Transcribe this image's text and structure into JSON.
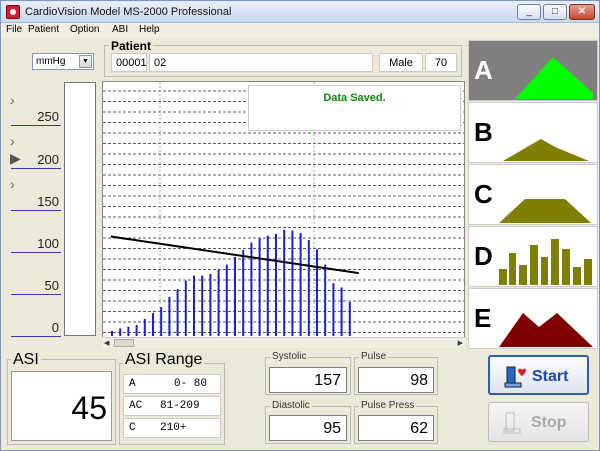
{
  "window": {
    "title": "CardioVision Model MS-2000 Professional"
  },
  "menu": [
    "File",
    "Patient",
    "Option",
    "ABI",
    "Help"
  ],
  "unit_select": {
    "value": "mmHg"
  },
  "patient": {
    "legend": "Patient",
    "id": "00001",
    "name": "02",
    "sex": "Male",
    "age": "70"
  },
  "scale": {
    "ticks": [
      "250",
      "200",
      "150",
      "100",
      "50",
      "0"
    ]
  },
  "status": {
    "message": "Data Saved."
  },
  "waveforms": [
    {
      "letter": "A",
      "shape": "mountain",
      "color": "#00ff00",
      "active": true
    },
    {
      "letter": "B",
      "shape": "flat-hill",
      "color": "#808000",
      "active": false
    },
    {
      "letter": "C",
      "shape": "trapezoid",
      "color": "#808000",
      "active": false
    },
    {
      "letter": "D",
      "shape": "bars",
      "color": "#808000",
      "active": false
    },
    {
      "letter": "E",
      "shape": "twin-peak",
      "color": "#800000",
      "active": false
    }
  ],
  "asi": {
    "label": "ASI",
    "value": "45"
  },
  "asi_range": {
    "label": "ASI Range",
    "rows": [
      {
        "code": "A",
        "range": "0- 80"
      },
      {
        "code": "AC",
        "range": "81-209"
      },
      {
        "code": "C",
        "range": "210+"
      }
    ]
  },
  "readings": {
    "systolic": {
      "label": "Systolic",
      "value": "157"
    },
    "pulse": {
      "label": "Pulse",
      "value": "98"
    },
    "diastolic": {
      "label": "Diastolic",
      "value": "95"
    },
    "pulse_press": {
      "label": "Pulse Press",
      "value": "62"
    }
  },
  "buttons": {
    "start": "Start",
    "stop": "Stop"
  },
  "colors": {
    "bars": "#1f1fd0",
    "trend": "#000000",
    "status": "#0a8a0a",
    "grid_vertical": "#7ec87e"
  },
  "chart_data": {
    "type": "bar",
    "y_unit": "mmHg",
    "bars": [
      6,
      9,
      11,
      13,
      20,
      27,
      34,
      46,
      55,
      65,
      71,
      71,
      73,
      78,
      84,
      93,
      101,
      110,
      115,
      118,
      120,
      125,
      124,
      121,
      113,
      102,
      84,
      62,
      57,
      40
    ],
    "trend": [
      {
        "index": 0,
        "value": 117
      },
      {
        "index": 29,
        "value": 74
      }
    ]
  }
}
